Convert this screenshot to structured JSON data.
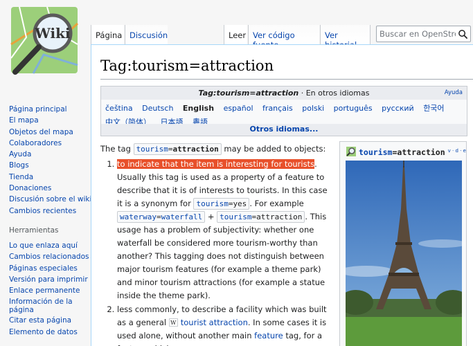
{
  "logo": {
    "text": "Wiki"
  },
  "sidebar": {
    "nav": [
      "Página principal",
      "El mapa",
      "Objetos del mapa",
      "Colaboradores",
      "Ayuda",
      "Blogs",
      "Tienda",
      "Donaciones",
      "Discusión sobre el wiki",
      "Cambios recientes"
    ],
    "tools_heading": "Herramientas",
    "tools": [
      "Lo que enlaza aquí",
      "Cambios relacionados",
      "Páginas especiales",
      "Versión para imprimir",
      "Enlace permanente",
      "Información de la página",
      "Citar esta página",
      "Elemento de datos"
    ]
  },
  "tabs": {
    "page": "Página",
    "discussion": "Discusión",
    "read": "Leer",
    "view_source": "Ver código fuente",
    "history": "Ver historial"
  },
  "search": {
    "placeholder": "Buscar en OpenStreetMap Wiki"
  },
  "page": {
    "title": "Tag:tourism=attraction"
  },
  "langbox": {
    "title_tag": "Tag:tourism=attraction",
    "title_rest": " · En otros idiomas",
    "help": "Ayuda",
    "languages": [
      "čeština",
      "Deutsch",
      "English",
      "español",
      "français",
      "polski",
      "português",
      "русский",
      "한국어",
      "中文（简体）",
      "日本語",
      "粵語"
    ],
    "current": "English",
    "more": "Otros idiomas..."
  },
  "content": {
    "intro_prefix": "The tag ",
    "intro_suffix": " may be added to objects:",
    "tag_key": "tourism",
    "tag_eq": "=",
    "tag_value": "attraction",
    "item1_highlight": "to indicate that the item is interesting for tourists",
    "item1_a": ". Usually this tag is used as a property of a feature to describe that it is of interests to tourists. In this case it is a synonym for ",
    "yes_value": "yes",
    "item1_b": ". For example ",
    "waterway_key": "waterway",
    "waterfall_value": "waterfall",
    "plus": " + ",
    "item1_c": ". This usage has a problem of subjectivity: whether one waterfall be considered more tourism-worthy than another? This tagging does not distinguish between major tourism features (for example a theme park) and minor tourism attractions (for example a statue inside the theme park).",
    "item2_a": "less commonly, to describe a facility which was built as a general ",
    "wiki_link": "tourist attraction",
    "item2_b": ". In some cases it is used alone, without another main ",
    "feature_link": "feature",
    "item2_c": " tag, for a feature which"
  },
  "infobox": {
    "key": "tourism",
    "eq": "=",
    "value": "attraction",
    "vde": "v · d · e"
  }
}
